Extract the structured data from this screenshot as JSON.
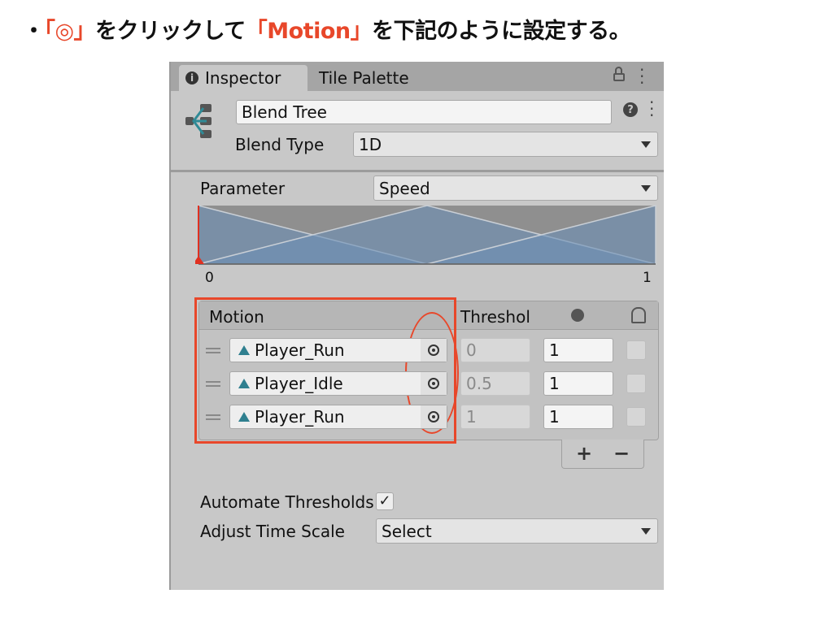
{
  "instruction": {
    "bullet": "・",
    "pre": "「◎」",
    "mid": "をクリックして",
    "motion": "「Motion」",
    "post": "を下記のように設定する。",
    "accent": "#e8472a"
  },
  "tabs": [
    {
      "label": "Inspector",
      "icon": "info-icon",
      "active": true
    },
    {
      "label": "Tile Palette",
      "active": false
    }
  ],
  "header": {
    "name": "Blend Tree",
    "blend_type_label": "Blend Type",
    "blend_type_value": "1D"
  },
  "parameter": {
    "label": "Parameter",
    "value": "Speed"
  },
  "graph": {
    "min_label": "0",
    "max_label": "1",
    "current_value": 0,
    "fill_color": "#6d8fb5"
  },
  "motion_list": {
    "headers": {
      "motion": "Motion",
      "threshold": "Threshol",
      "speed_icon": "time-scale-icon",
      "mirror_icon": "mirror-icon"
    },
    "rows": [
      {
        "motion": "Player_Run",
        "threshold": "0",
        "speed": "1",
        "mirror": false
      },
      {
        "motion": "Player_Idle",
        "threshold": "0.5",
        "speed": "1",
        "mirror": false
      },
      {
        "motion": "Player_Run",
        "threshold": "1",
        "speed": "1",
        "mirror": false
      }
    ],
    "add_label": "+",
    "remove_label": "−"
  },
  "automate_thresholds": {
    "label": "Automate Thresholds",
    "checked": true,
    "check": "✓"
  },
  "adjust_time_scale": {
    "label": "Adjust Time Scale",
    "value": "Select"
  },
  "highlight_color": "#e8472a"
}
